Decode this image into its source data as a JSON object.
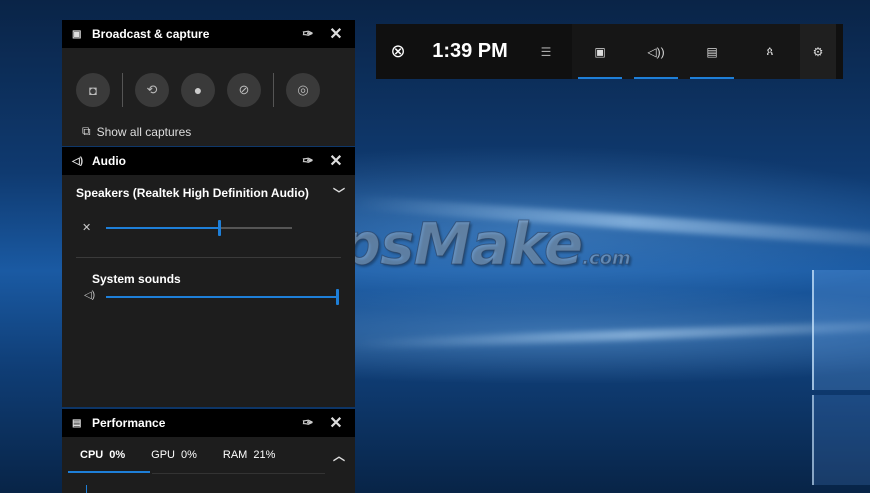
{
  "watermark": {
    "text": "TipsMake",
    "suffix": ".com"
  },
  "broadcast": {
    "title": "Broadcast & capture",
    "header_icon": "capture-icon",
    "buttons": [
      {
        "name": "screenshot",
        "icon": "camera-icon"
      },
      {
        "name": "record-last",
        "icon": "replay-icon"
      },
      {
        "name": "record",
        "icon": "record-icon"
      },
      {
        "name": "mic",
        "icon": "mic-off-icon"
      },
      {
        "name": "broadcast",
        "icon": "broadcast-icon"
      }
    ],
    "show_all": "Show all captures"
  },
  "audio": {
    "title": "Audio",
    "device": "Speakers (Realtek High Definition Audio)",
    "master_volume": 0.6,
    "master_muted": true,
    "system_label": "System sounds",
    "system_volume": 1.0
  },
  "performance": {
    "title": "Performance",
    "tabs": [
      {
        "label": "CPU",
        "value": "0%"
      },
      {
        "label": "GPU",
        "value": "0%"
      },
      {
        "label": "RAM",
        "value": "21%"
      }
    ]
  },
  "topbar": {
    "time": "1:39 PM",
    "widgets": [
      {
        "name": "capture",
        "active": true
      },
      {
        "name": "audio",
        "active": true
      },
      {
        "name": "performance",
        "active": true
      },
      {
        "name": "social",
        "active": false
      },
      {
        "name": "settings",
        "active": false
      }
    ]
  },
  "colors": {
    "accent": "#1e7fd8",
    "panel": "#1f1f1f",
    "header": "#000000"
  }
}
